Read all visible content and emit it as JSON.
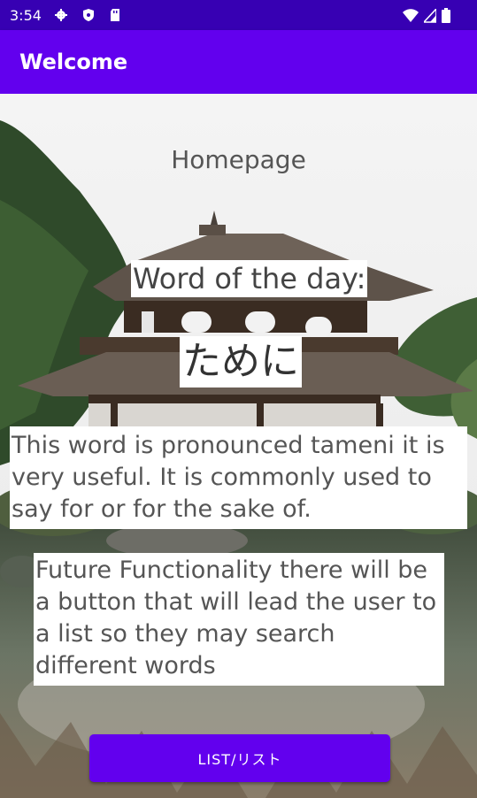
{
  "status_bar": {
    "time": "3:54",
    "left_icons": [
      "gear-icon",
      "shield-icon",
      "sd-card-icon"
    ],
    "right_icons": [
      "wifi-icon",
      "signal-icon",
      "battery-icon"
    ]
  },
  "app_bar": {
    "title": "Welcome"
  },
  "main": {
    "heading": "Homepage",
    "word_of_day_label": "Word of the day:",
    "word": "ために",
    "description": "This word is pronounced tameni it is very useful. It is commonly used to say for or for the sake of.",
    "future_note": "Future Functionality there will be a button that will lead the user to a list so they may search different words",
    "list_button_label": "LIST/リスト"
  },
  "colors": {
    "primary": "#6200ee",
    "primary_dark": "#3700b3",
    "text": "#555555"
  }
}
